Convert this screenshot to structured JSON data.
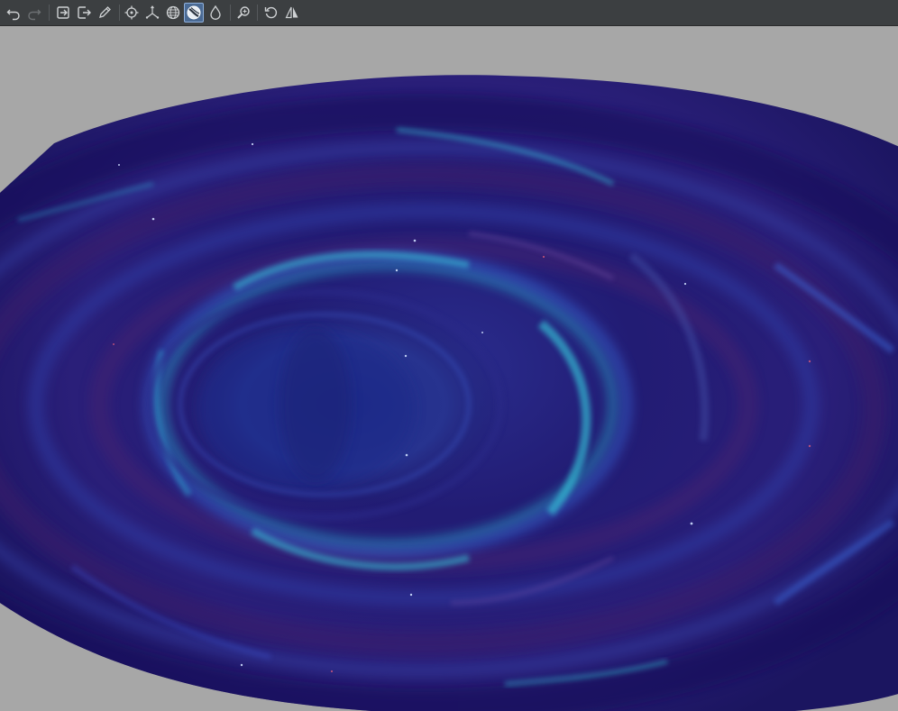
{
  "app": {
    "toolbar_title": ""
  },
  "toolbar": {
    "buttons": [
      {
        "icon": "undo-icon",
        "enabled": true
      },
      {
        "icon": "redo-icon",
        "enabled": false
      },
      {
        "icon": "import-icon",
        "enabled": true
      },
      {
        "icon": "export-icon",
        "enabled": true
      },
      {
        "icon": "pencil-icon",
        "enabled": true
      },
      {
        "icon": "crosshair-icon",
        "enabled": true
      },
      {
        "icon": "axes-icon",
        "enabled": true
      },
      {
        "icon": "sphere-mesh-icon",
        "enabled": true
      },
      {
        "icon": "texture-sphere-icon",
        "enabled": true,
        "active": true
      },
      {
        "icon": "drop-icon",
        "enabled": true
      },
      {
        "icon": "zoom-icon",
        "enabled": true
      },
      {
        "icon": "reset-rotation-icon",
        "enabled": true
      },
      {
        "icon": "mirror-icon",
        "enabled": true
      }
    ]
  },
  "viewport": {
    "background_color": "#a7a7a7",
    "object": "warped-galaxy-disc",
    "colors": {
      "deep": "#1b1560",
      "mid": "#2a2a8a",
      "blue": "#3a4fc8",
      "cyan": "#36c5d8",
      "purple": "#4a2370"
    }
  }
}
